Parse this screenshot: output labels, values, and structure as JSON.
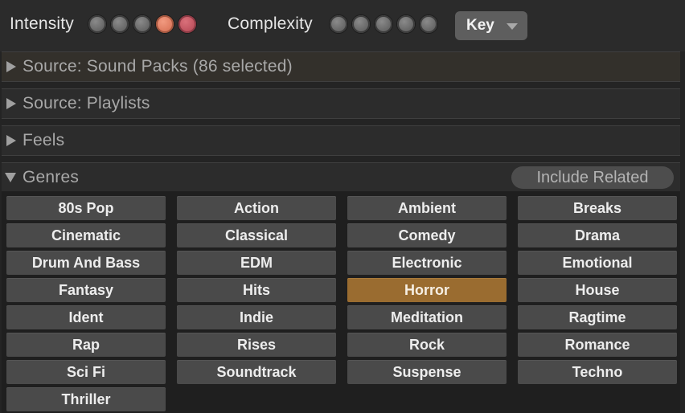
{
  "topbar": {
    "intensity_label": "Intensity",
    "intensity_level": 4,
    "intensity_max": 5,
    "complexity_label": "Complexity",
    "complexity_level": 0,
    "complexity_max": 5,
    "key_select": {
      "label": "Key"
    }
  },
  "sections": {
    "sound_packs": "Source: Sound Packs (86 selected)",
    "playlists": "Source: Playlists",
    "feels": "Feels",
    "genres": "Genres",
    "include_related": "Include Related"
  },
  "genres": [
    {
      "label": "80s Pop",
      "selected": false
    },
    {
      "label": "Action",
      "selected": false
    },
    {
      "label": "Ambient",
      "selected": false
    },
    {
      "label": "Breaks",
      "selected": false
    },
    {
      "label": "Cinematic",
      "selected": false
    },
    {
      "label": "Classical",
      "selected": false
    },
    {
      "label": "Comedy",
      "selected": false
    },
    {
      "label": "Drama",
      "selected": false
    },
    {
      "label": "Drum And Bass",
      "selected": false
    },
    {
      "label": "EDM",
      "selected": false
    },
    {
      "label": "Electronic",
      "selected": false
    },
    {
      "label": "Emotional",
      "selected": false
    },
    {
      "label": "Fantasy",
      "selected": false
    },
    {
      "label": "Hits",
      "selected": false
    },
    {
      "label": "Horror",
      "selected": true
    },
    {
      "label": "House",
      "selected": false
    },
    {
      "label": "Ident",
      "selected": false
    },
    {
      "label": "Indie",
      "selected": false
    },
    {
      "label": "Meditation",
      "selected": false
    },
    {
      "label": "Ragtime",
      "selected": false
    },
    {
      "label": "Rap",
      "selected": false
    },
    {
      "label": "Rises",
      "selected": false
    },
    {
      "label": "Rock",
      "selected": false
    },
    {
      "label": "Romance",
      "selected": false
    },
    {
      "label": "Sci Fi",
      "selected": false
    },
    {
      "label": "Soundtrack",
      "selected": false
    },
    {
      "label": "Suspense",
      "selected": false
    },
    {
      "label": "Techno",
      "selected": false
    },
    {
      "label": "Thriller",
      "selected": false
    }
  ],
  "colors": {
    "selected_genre": "#9a6c30",
    "intensity_dot_4": "#e07e63",
    "intensity_dot_5": "#c25662"
  }
}
